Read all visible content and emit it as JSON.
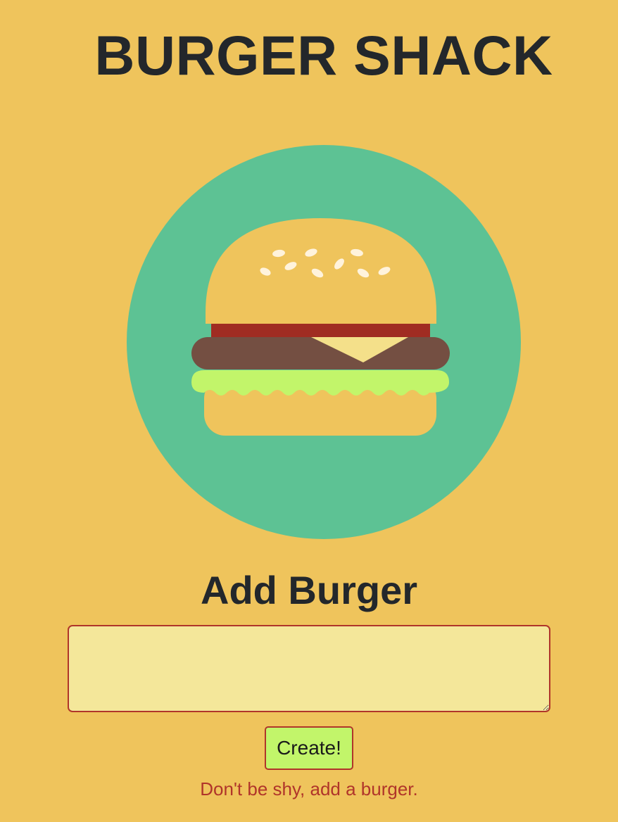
{
  "header": {
    "title": "BURGER SHACK"
  },
  "logo": {
    "icon": "burger-logo-icon",
    "colors": {
      "circle": "#5dc294",
      "bun": "#efc45c",
      "sesame": "#fff3dc",
      "sauce": "#a02c22",
      "patty": "#744f42",
      "cheese": "#f4e08a",
      "lettuce": "#c2f56a"
    }
  },
  "form": {
    "heading": "Add Burger",
    "input_value": "",
    "input_placeholder": "",
    "submit_label": "Create!",
    "helper_text": "Don't be shy, add a burger."
  },
  "theme": {
    "background": "#efc45c",
    "text": "#23272b",
    "accent": "#b0352a",
    "input_background": "#f4e79a",
    "button_background": "#c2f56a"
  }
}
